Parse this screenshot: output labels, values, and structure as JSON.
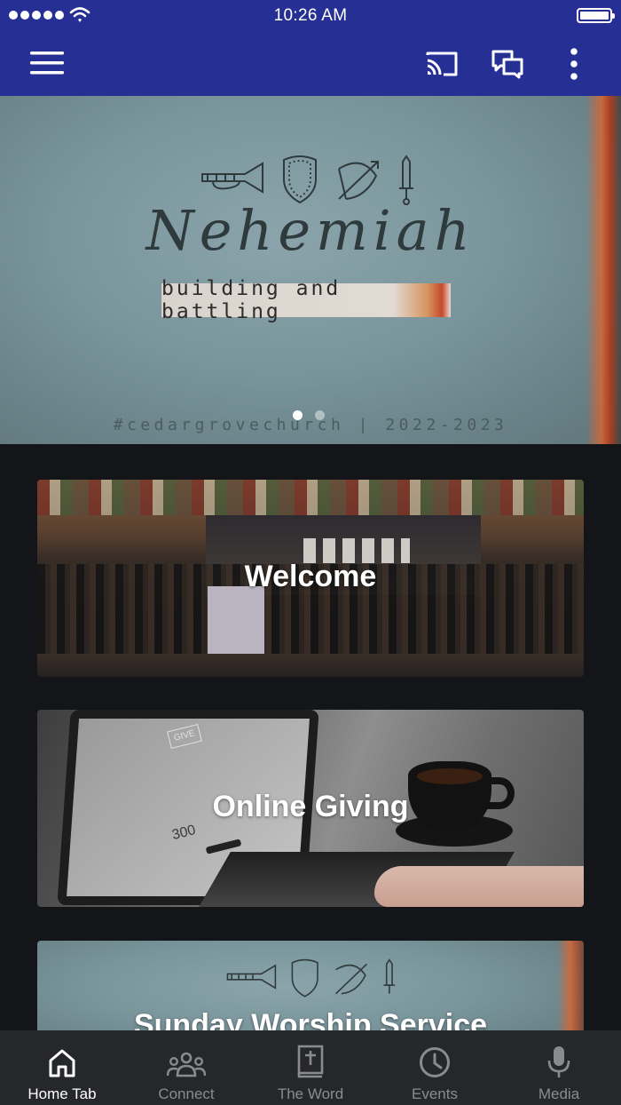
{
  "status_bar": {
    "time": "10:26 AM"
  },
  "app_bar": {
    "menu_icon": "hamburger-menu-icon",
    "cast_icon": "cast-icon",
    "chat_icon": "chat-bubbles-icon",
    "more_icon": "more-vertical-icon",
    "background_color": "#262f93"
  },
  "hero": {
    "title": "Nehemiah",
    "subtitle": "building and battling",
    "hashtag": "#cedargrovechurch  |  2022-2023",
    "icons": [
      "trumpet-icon",
      "shield-icon",
      "bow-and-arrow-icon",
      "sword-icon"
    ],
    "slides_total": 2,
    "slide_active": 1
  },
  "cards": [
    {
      "label": "Welcome"
    },
    {
      "label": "Online Giving"
    },
    {
      "label": "Sunday Worship Service"
    }
  ],
  "giving_photo_text": {
    "give": "GIVE",
    "amount": "300"
  },
  "bottom_nav": {
    "items": [
      {
        "label": "Home Tab",
        "icon": "home-icon",
        "active": true
      },
      {
        "label": "Connect",
        "icon": "people-group-icon",
        "active": false
      },
      {
        "label": "The Word",
        "icon": "bible-icon",
        "active": false
      },
      {
        "label": "Events",
        "icon": "clock-icon",
        "active": false
      },
      {
        "label": "Media",
        "icon": "microphone-icon",
        "active": false
      }
    ]
  }
}
